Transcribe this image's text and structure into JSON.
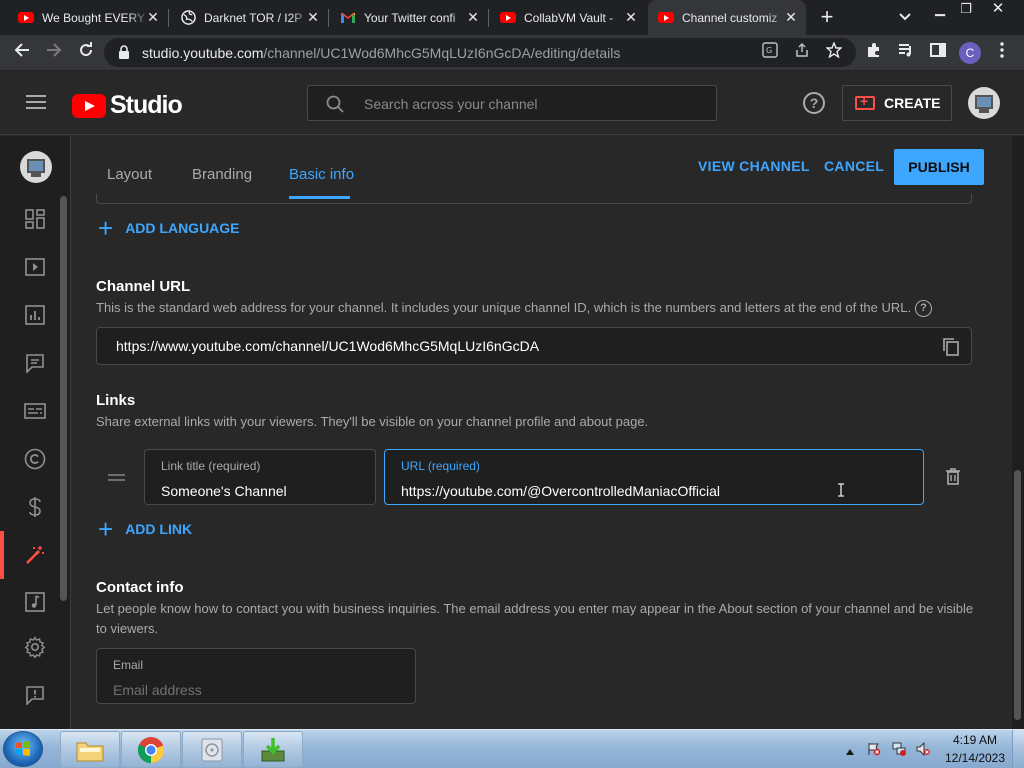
{
  "browser": {
    "tabs": [
      {
        "title": "We Bought EVERY",
        "icon": "youtube-icon"
      },
      {
        "title": "Darknet TOR / I2P",
        "icon": "globe-icon"
      },
      {
        "title": "Your Twitter confi",
        "icon": "gmail-icon"
      },
      {
        "title": "CollabVM Vault -",
        "icon": "youtube-icon"
      },
      {
        "title": "Channel customiz",
        "icon": "youtube-icon",
        "active": true
      }
    ],
    "url_host": "studio.youtube.com",
    "url_path": "/channel/UC1Wod6MhcG5MqLUzI6nGcDA/editing/details",
    "profile_initial": "C"
  },
  "header": {
    "logo_text": "Studio",
    "search_placeholder": "Search across your channel",
    "help_label": "?",
    "create_label": "CREATE"
  },
  "content_tabs": [
    {
      "label": "Layout"
    },
    {
      "label": "Branding"
    },
    {
      "label": "Basic info",
      "active": true
    }
  ],
  "actions": {
    "view_channel": "VIEW CHANNEL",
    "cancel": "CANCEL",
    "publish": "PUBLISH"
  },
  "language": {
    "add_label": "ADD LANGUAGE"
  },
  "channel_url": {
    "title": "Channel URL",
    "description": "This is the standard web address for your channel. It includes your unique channel ID, which is the numbers and letters at the end of the URL.",
    "help": "?",
    "value": "https://www.youtube.com/channel/UC1Wod6MhcG5MqLUzI6nGcDA"
  },
  "links": {
    "title": "Links",
    "description": "Share external links with your viewers. They'll be visible on your channel profile and about page.",
    "items": [
      {
        "title_label": "Link title (required)",
        "title_value": "Someone's Channel",
        "url_label": "URL (required)",
        "url_value": "https://youtube.com/@OvercontrolledManiacOfficial"
      }
    ],
    "add_label": "ADD LINK"
  },
  "contact": {
    "title": "Contact info",
    "description": "Let people know how to contact you with business inquiries. The email address you enter may appear in the About section of your channel and be visible to viewers.",
    "email_label": "Email",
    "email_placeholder": "Email address"
  },
  "taskbar": {
    "time": "4:19 AM",
    "date": "12/14/2023"
  },
  "colors": {
    "accent": "#3ea6ff",
    "brand_red": "#ff0000",
    "nav_active": "#ff4e45"
  }
}
